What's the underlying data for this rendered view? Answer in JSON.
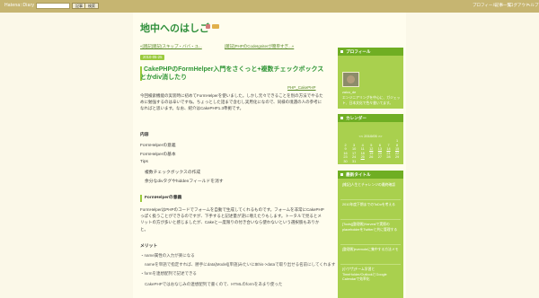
{
  "topbar": {
    "brand": "Hatena::Diary",
    "button_primary": "記事",
    "button_secondary": "検索",
    "nav": [
      "プロフィール",
      "記事一覧",
      "ログアウト",
      "ヘルプ"
    ]
  },
  "blog": {
    "title": "地中へのはしご",
    "badge_colors": [
      "#d37a7a",
      "#e1b04b"
    ]
  },
  "entry": {
    "prev_link": "«[雑記]雑記(スキップ・ババ・ユ...",
    "next_link": "[雑記]PHPのCodeIgniterが簡単すぎ...»",
    "date": "2010-05-25",
    "title": "CakePHPのFormHelper入門をさくっと+複数チェックボックスとかdiv消したり",
    "category": "PHP_CakePHP",
    "intro": "今回検索機能の実装時に初めてFormHelperを使いました。しかし元々できることを別の方法でやるために勉強するのは辛いですね。ちょっとした話まで含むし実用化になので、同様の境遇の人の参考になればと思います。なお、紹介はCakePHP1.3準拠です。",
    "toc_heading": "内容",
    "toc": [
      "FormHelperの意義",
      "FormHelperの基本",
      "Tips",
      "複数チェックボックスの作成",
      "余分なdivタグやhiddenフィールドを消す"
    ],
    "section_heading": "FormHelperの意義",
    "section_text": "FormHelperはPHPのコードでフォームを自動で生成してくれるものです。フォームを非常にCakePHPっぽく扱うことができるのですが、下手すると記述量が逆に増えたりもします。トータルで見るとメリットの方が多いと感じましたが、Cakeと一度限りの付き合いなら使わないという選択肢もありかと。",
    "merit_heading": "メリット",
    "merits": [
      "・name属性の入力が楽になる",
      "nameを単語で指定すれば、勝手にdata[Model][単語]みたいに$this->dataで取り出せる名前にしてくれます",
      "・formを連想配列で記述できる",
      "CakePHPではおなじみの連想配列で書くので、HTMLのformをあまり使った"
    ]
  },
  "sidebar": {
    "profile_heading": "プロフィール",
    "profile_name": "zaico_de",
    "profile_text": "エンジニアリングを中心に、ガジェット、日本文化で色々書いてます。",
    "calendar_heading": "カレンダー",
    "calendar_month": "<< 2010/05 >>",
    "calendar_rows": [
      [
        "",
        "",
        "",
        "",
        "",
        "",
        "1"
      ],
      [
        "2",
        "3",
        "4",
        "5",
        "6",
        "7",
        "8"
      ],
      [
        "9",
        "10",
        "11",
        "12",
        "13",
        "14",
        "15"
      ],
      [
        "16",
        "17",
        "18",
        "19",
        "20",
        "21",
        "22"
      ],
      [
        "23",
        "24",
        "25",
        "26",
        "27",
        "28",
        "29"
      ],
      [
        "30",
        "31",
        "",
        "",
        "",
        "",
        ""
      ]
    ],
    "recent_heading": "最新タイトル",
    "recent": [
      "[雑記]人生とチャレンジの最終確認",
      "2010年度下期までのToDoを考える",
      "[Tools][整理術]Harvestで実際のplaceholderをTwitterと共に管理する",
      "[整理術]evernoteに集中する方法メモ",
      "[小ワザ]チーム学習とTimeHolder/OutlookとGoogle Calendarで効率化"
    ]
  }
}
